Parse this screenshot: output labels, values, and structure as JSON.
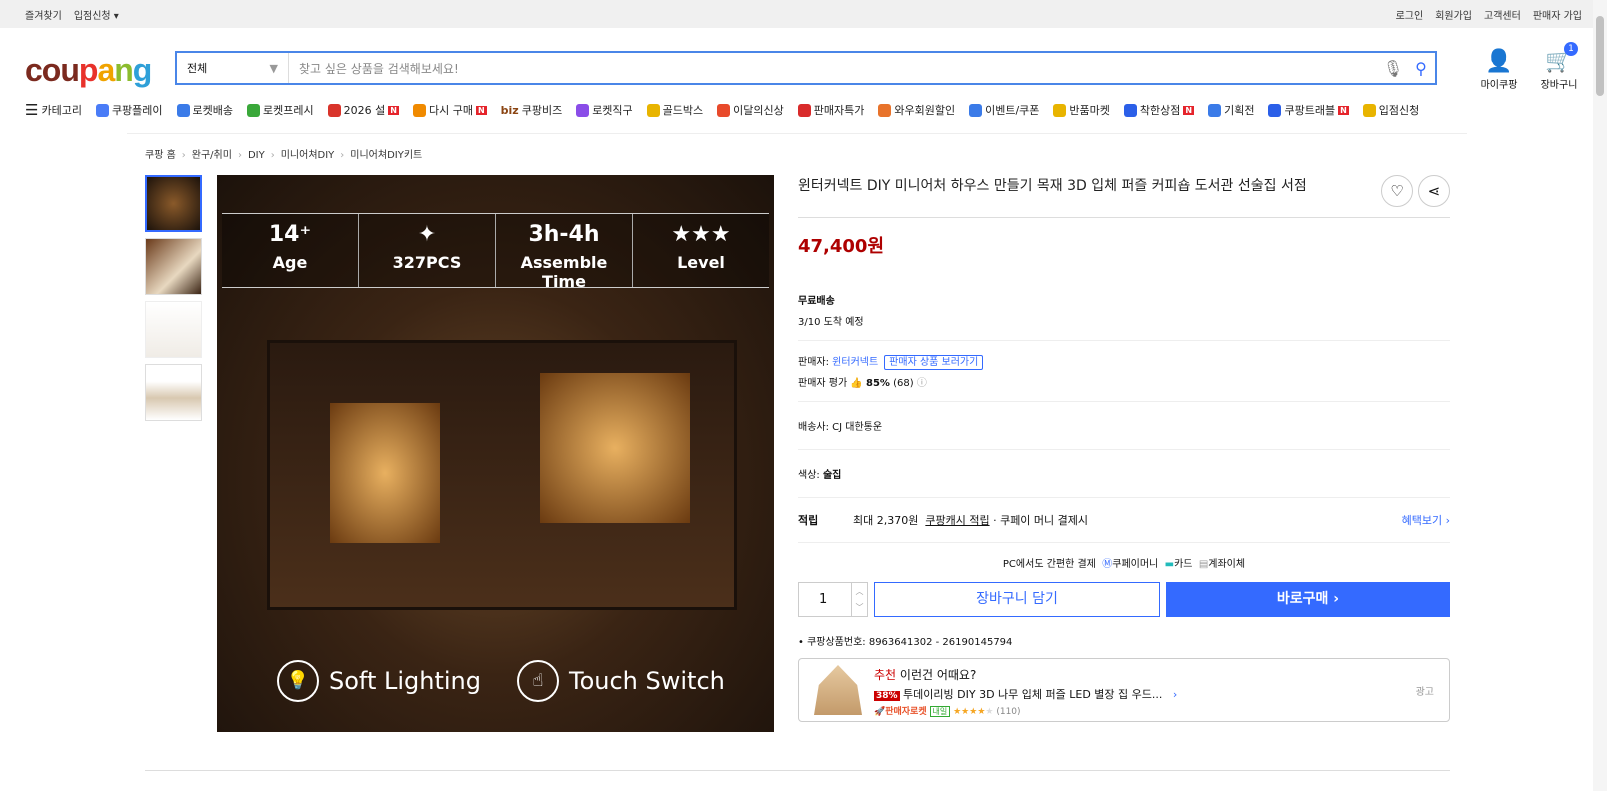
{
  "topbar": {
    "left": [
      "즐겨찾기",
      "입점신청 ▾"
    ],
    "right": [
      "로그인",
      "회원가입",
      "고객센터",
      "판매자 가입"
    ]
  },
  "header": {
    "logo": "coupang",
    "search_category": "전체",
    "search_placeholder": "찾고 싶은 상품을 검색해보세요!",
    "mypage": "마이쿠팡",
    "cart": "장바구니",
    "cart_count": "1"
  },
  "nav": [
    {
      "label": "카테고리",
      "color": "#333"
    },
    {
      "label": "쿠팡플레이",
      "color": "#4a7cf7"
    },
    {
      "label": "로켓배송",
      "color": "#3b7be8"
    },
    {
      "label": "로켓프레시",
      "color": "#3aa83a"
    },
    {
      "label": "2026 설",
      "color": "#d9342b",
      "n": "N"
    },
    {
      "label": "다시 구매",
      "color": "#f08a00",
      "n": "N"
    },
    {
      "label": "쿠팡비즈",
      "color": "#8b4513",
      "prefix": "biz"
    },
    {
      "label": "로켓직구",
      "color": "#8a4de8"
    },
    {
      "label": "골드박스",
      "color": "#e8b400"
    },
    {
      "label": "이달의신상",
      "color": "#e84a2b"
    },
    {
      "label": "판매자특가",
      "color": "#d92b2b"
    },
    {
      "label": "와우회원할인",
      "color": "#e8732b"
    },
    {
      "label": "이벤트/쿠폰",
      "color": "#3b7be8"
    },
    {
      "label": "반품마켓",
      "color": "#e8b400"
    },
    {
      "label": "착한상점",
      "color": "#2b5fe8",
      "n": "N"
    },
    {
      "label": "기획전",
      "color": "#3b7be8"
    },
    {
      "label": "쿠팡트래블",
      "color": "#2b5fe8",
      "n": "N"
    },
    {
      "label": "입점신청",
      "color": "#e8b400"
    }
  ],
  "breadcrumb": [
    "쿠팡 홈",
    "완구/취미",
    "DIY",
    "미니어쳐DIY",
    "미니어쳐DIY키트"
  ],
  "image": {
    "specs": [
      {
        "a": "14⁺",
        "b": "Age"
      },
      {
        "a": "✦",
        "b": "327PCS"
      },
      {
        "a": "3h-4h",
        "b": "Assemble Time"
      },
      {
        "a": "★★★",
        "b": "Level"
      }
    ],
    "features": [
      "Soft Lighting",
      "Touch Switch"
    ]
  },
  "product": {
    "title": "윈터커넥트 DIY 미니어처 하우스 만들기 목재 3D 입체 퍼즐 커피숍 도서관 선술집 서점",
    "price": "47,400원",
    "shipping": "무료배송",
    "arrival": "3/10 도착 예정",
    "seller_label": "판매자:",
    "seller": "윈터커넥트",
    "seller_tip": "판매자 상품 보러가기",
    "rating_label": "판매자 평가",
    "rating": "85%",
    "rating_count": "(68)",
    "courier": "배송사:  CJ 대한통운",
    "color": "색상:",
    "color_value": "술집",
    "points_label": "적립",
    "points_text": "최대 2,370원",
    "points_link": "쿠팡캐시 적립",
    "points_suffix": "· 쿠페이 머니 결제시",
    "benefit": "혜택보기 ›",
    "pay_title": "PC에서도 간편한 결제",
    "pay_methods": [
      "쿠페이머니",
      "카드",
      "계좌이체"
    ],
    "qty": "1",
    "add_cart": "장바구니 담기",
    "buy_now": "바로구매 ›",
    "product_no": "쿠팡상품번호: 8963641302 - 26190145794"
  },
  "rec": {
    "hl": "추천",
    "title": "이런건 어때요?",
    "discount": "38%",
    "name": "투데이리빙 DIY 3D 나무 입체 퍼즐 LED 별장 집 우드...",
    "rocket": "판매자로켓",
    "tomorrow": "내일",
    "stars": "★★★★",
    "star_empty": "★",
    "count": "(110)",
    "ad": "광고"
  }
}
